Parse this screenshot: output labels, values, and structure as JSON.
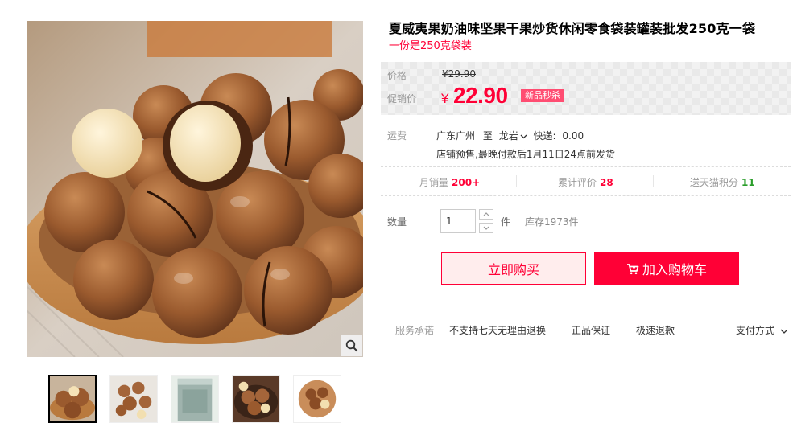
{
  "product": {
    "title": "夏威夷果奶油味坚果干果炒货休闲零食袋装罐装批发250克一袋",
    "subtitle": "一份是250克袋装"
  },
  "gallery": {
    "zoom_icon": "search-icon",
    "thumbnails": [
      "macadamia-bowl-closeup",
      "macadamia-scattered",
      "foil-bag-package",
      "macadamia-dark-bowl",
      "macadamia-round-bowl"
    ],
    "active_thumbnail": 0
  },
  "price": {
    "label": "价格",
    "currency": "¥",
    "original": "29.90",
    "promo_label": "促销价",
    "promo": "22.90",
    "badge": "新品秒杀"
  },
  "shipping": {
    "label": "运费",
    "from": "广东广州",
    "to_word": "至",
    "dest": "龙岩",
    "express_label": "快递:",
    "express_fee": "0.00",
    "note": "店铺预售,最晚付款后1月11日24点前发货"
  },
  "stats": {
    "monthly_sales_label": "月销量",
    "monthly_sales": "200+",
    "reviews_label": "累计评价",
    "reviews": "28",
    "points_label": "送天猫积分",
    "points": "11"
  },
  "quantity": {
    "label": "数量",
    "value": "1",
    "unit": "件",
    "stock": "库存1973件"
  },
  "actions": {
    "buy_now": "立即购买",
    "add_to_cart": "加入购物车"
  },
  "service": {
    "label": "服务承诺",
    "items": [
      "不支持七天无理由退换",
      "正品保证",
      "极速退款"
    ],
    "payment": "支付方式"
  },
  "colors": {
    "accent": "#ff0036",
    "accent_light": "#ffeded",
    "badge": "#ff4d72",
    "points": "#2a9d2a"
  }
}
